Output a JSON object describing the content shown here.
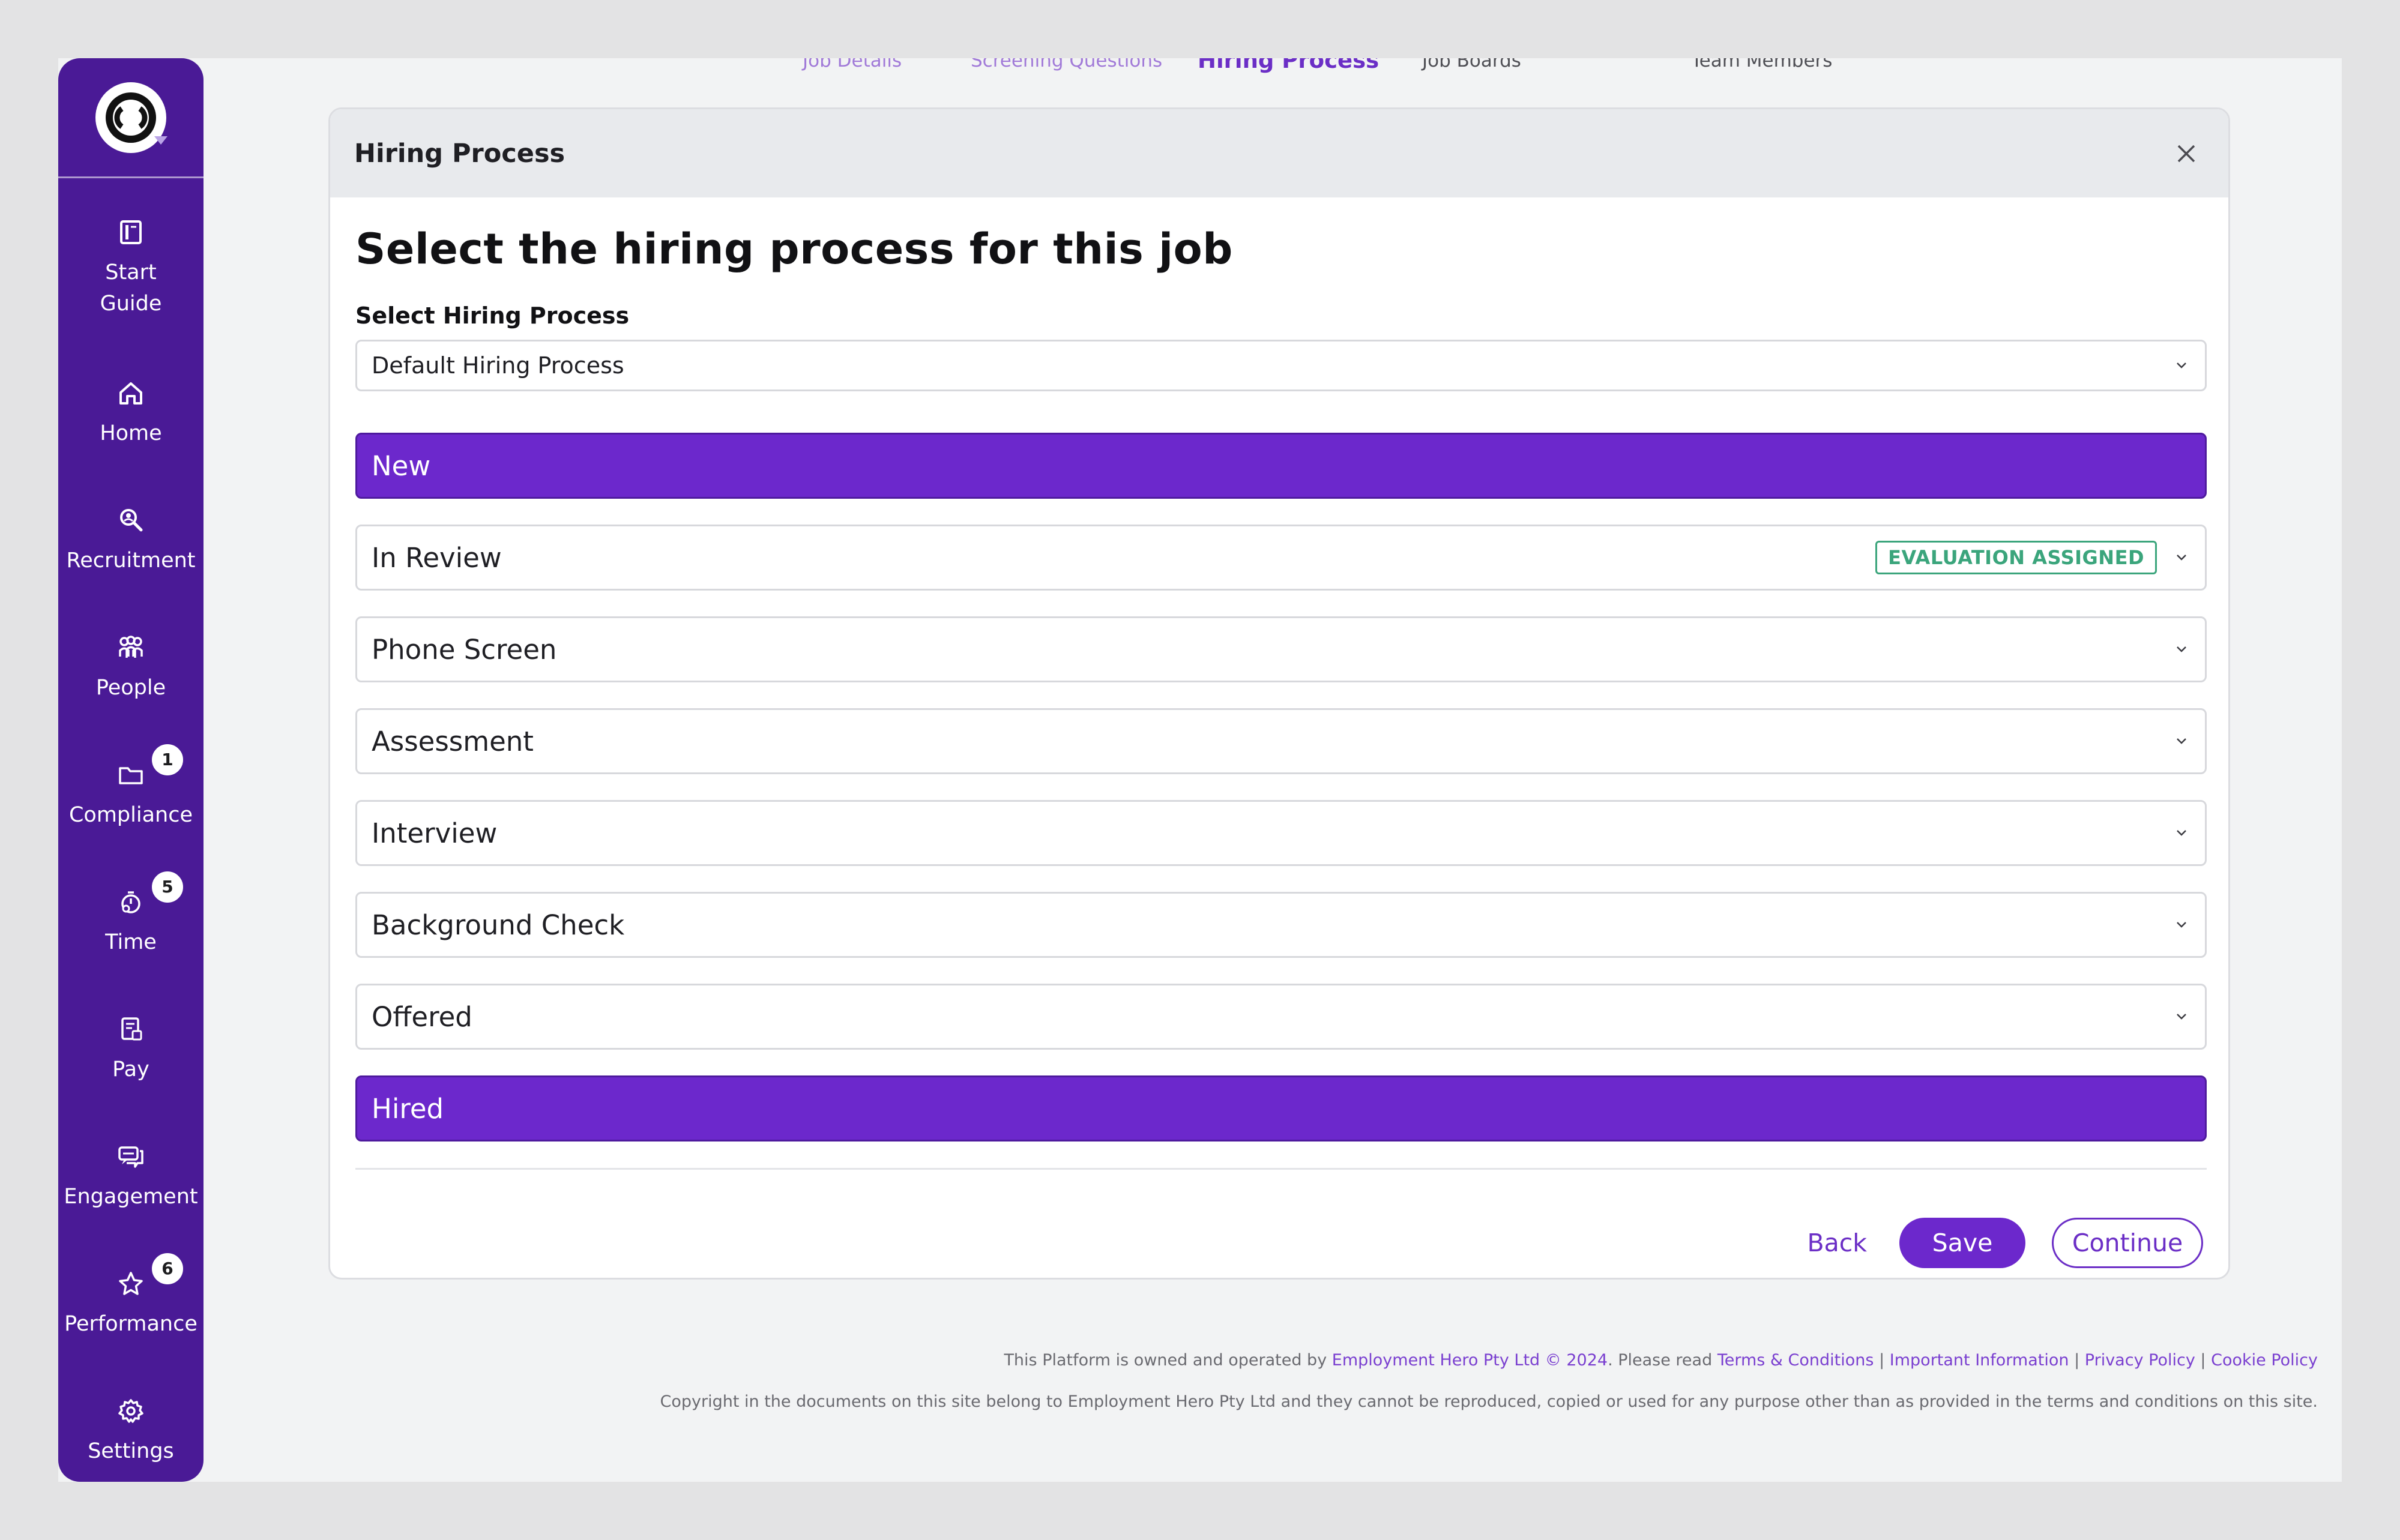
{
  "sidebar": {
    "items": [
      {
        "label_line1": "Start",
        "label_line2": "Guide",
        "icon": "book-icon"
      },
      {
        "label": "Home",
        "icon": "home-icon"
      },
      {
        "label": "Recruitment",
        "icon": "recruit-search-icon"
      },
      {
        "label": "People",
        "icon": "people-icon"
      },
      {
        "label": "Compliance",
        "icon": "folder-icon",
        "badge": "1"
      },
      {
        "label": "Time",
        "icon": "timer-icon",
        "badge": "5"
      },
      {
        "label": "Pay",
        "icon": "payslip-icon"
      },
      {
        "label": "Engagement",
        "icon": "chat-icon"
      },
      {
        "label": "Performance",
        "icon": "star-icon",
        "badge": "6"
      },
      {
        "label": "Settings",
        "icon": "gear-icon"
      }
    ]
  },
  "tabs": [
    {
      "label": "Job Details"
    },
    {
      "label": "Screening Questions"
    },
    {
      "label": "Hiring Process"
    },
    {
      "label": "Job Boards"
    },
    {
      "label": "Team Members"
    }
  ],
  "card": {
    "header_title": "Hiring Process",
    "main_title": "Select the hiring process for this job",
    "select_label": "Select Hiring Process",
    "select_value": "Default Hiring Process",
    "stages": [
      {
        "label": "New"
      },
      {
        "label": "In Review",
        "badge": "EVALUATION ASSIGNED"
      },
      {
        "label": "Phone Screen"
      },
      {
        "label": "Assessment"
      },
      {
        "label": "Interview"
      },
      {
        "label": "Background Check"
      },
      {
        "label": "Offered"
      },
      {
        "label": "Hired"
      }
    ],
    "back_label": "Back",
    "save_label": "Save",
    "continue_label": "Continue"
  },
  "footer": {
    "line1_pre": "This Platform is owned and operated by ",
    "company_link": "Employment Hero Pty Ltd © 2024",
    "line1_mid": ". Please read ",
    "terms_link": "Terms & Conditions",
    "important_link": "Important Information",
    "privacy_link": "Privacy Policy",
    "cookie_link": "Cookie Policy",
    "separator": "|",
    "line2": "Copyright in the documents on this site belong to Employment Hero Pty Ltd and they cannot be reproduced, copied or used for any purpose other than as provided in the terms and conditions on this site."
  },
  "colors": {
    "sidebar": "#4a1a96",
    "accent": "#6c28cc",
    "badge_green": "#3ba57c"
  }
}
